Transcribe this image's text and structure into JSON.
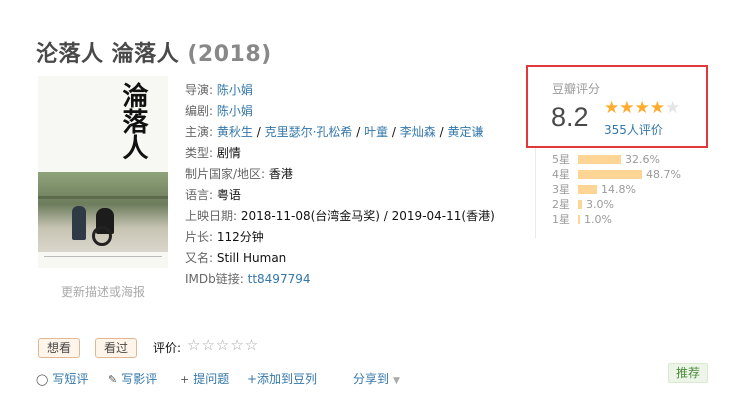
{
  "title": {
    "name": "沦落人 淪落人",
    "year": "(2018)"
  },
  "poster": {
    "title_chars": "淪落人",
    "link": "更新描述或海报"
  },
  "info": {
    "director": {
      "label": "导演:",
      "values": [
        "陈小娟"
      ]
    },
    "writer": {
      "label": "编剧:",
      "values": [
        "陈小娟"
      ]
    },
    "cast": {
      "label": "主演:",
      "values": [
        "黄秋生",
        "克里瑟尔·孔松希",
        "叶童",
        "李灿森",
        "黄定谦"
      ]
    },
    "genre": {
      "label": "类型:",
      "value": "剧情"
    },
    "region": {
      "label": "制片国家/地区:",
      "value": "香港"
    },
    "language": {
      "label": "语言:",
      "value": "粤语"
    },
    "release": {
      "label": "上映日期:",
      "value": "2018-11-08(台湾金马奖) / 2019-04-11(香港)"
    },
    "runtime": {
      "label": "片长:",
      "value": "112分钟"
    },
    "aka": {
      "label": "又名:",
      "value": "Still Human"
    },
    "imdb": {
      "label": "IMDb链接:",
      "value": "tt8497794"
    }
  },
  "rating": {
    "label": "豆瓣评分",
    "score": "8.2",
    "stars_filled": 4,
    "stars_total": 5,
    "count": "355人评价",
    "distribution": [
      {
        "label": "5星",
        "percent": "32.6%",
        "value": 32.6
      },
      {
        "label": "4星",
        "percent": "48.7%",
        "value": 48.7
      },
      {
        "label": "3星",
        "percent": "14.8%",
        "value": 14.8
      },
      {
        "label": "2星",
        "percent": "3.0%",
        "value": 3.0
      },
      {
        "label": "1星",
        "percent": "1.0%",
        "value": 1.0
      }
    ]
  },
  "interest": {
    "want": "想看",
    "seen": "看过",
    "rate_label": "评价:",
    "rate_stars": "☆☆☆☆☆"
  },
  "actions": {
    "short_review": "写短评",
    "review": "写影评",
    "question": "提问题",
    "doulist": "+添加到豆列",
    "share": "分享到",
    "recommend": "推荐"
  },
  "colors": {
    "link": "#3377aa",
    "star": "#ffac2d",
    "bar": "#ffd596",
    "highlight_border": "#e0383b"
  }
}
